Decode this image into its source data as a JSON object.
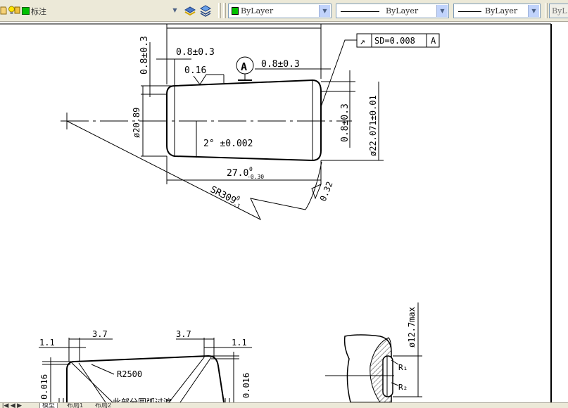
{
  "toolbar": {
    "style_combo": {
      "value": "标注"
    },
    "layer_combo": {
      "value": "ByLayer",
      "swatch_color": "#00c000"
    },
    "linetype_combo": {
      "value": "ByLayer"
    },
    "lineweight_combo": {
      "value": "ByLayer"
    },
    "plotstyle_combo": {
      "value": "ByL"
    },
    "icons": [
      "layer-state-icon",
      "lightbulb-icon",
      "green-square-icon",
      "layer-previous-icon",
      "layer-manager-icon"
    ]
  },
  "drawing": {
    "top_view": {
      "dim_top_vertical": "0.8±0.3",
      "dim_top_horizontal": "0.8±0.3",
      "surface_roughness": "0.16",
      "datum_label": "A",
      "dim_right_horizontal": "0.8±0.3",
      "tolerance_frame": {
        "symbol": "↗",
        "value": "SD=0.008",
        "datum": "A"
      },
      "dim_diameter_left": "ø20.89",
      "angle_tolerance": "2° ±0.002",
      "dim_right_vertical": "0.8±0.3",
      "dim_diameter_right": "ø22.071±0.01",
      "dim_length": "27.0",
      "length_tol_upper": "0",
      "length_tol_lower": "-0.30",
      "sphere_radius": "SR309",
      "sphere_radius_tol": "-1",
      "sphere_radius_tol_upper": "0",
      "roughness_right": "0.32"
    },
    "bottom_left_view": {
      "dim_left": "1.1",
      "dim_left_2": "3.7",
      "dim_right_2": "3.7",
      "dim_right": "1.1",
      "radius": "R2500",
      "height_left": "0.016",
      "height_right": "0.016",
      "note": "此部分圆弧过渡"
    },
    "bottom_right_view": {
      "diameter_max": "ø12.7max",
      "r1": "R₁",
      "r2": "R₂"
    }
  },
  "tabs": [
    "模型",
    "布局1",
    "布局2"
  ]
}
